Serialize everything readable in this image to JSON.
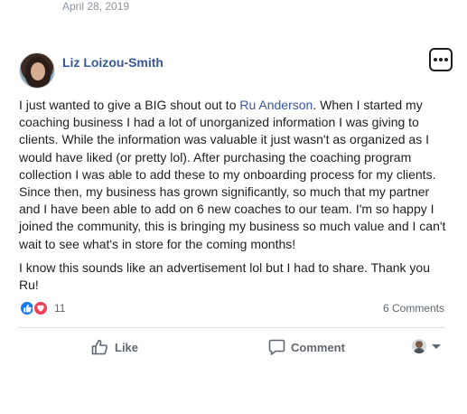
{
  "post": {
    "date_top": "April 28, 2019",
    "author": "Liz Loizou-Smith",
    "body_part1": "I just wanted to give a BIG shout out to ",
    "mention": "Ru Anderson",
    "body_part2": ". When I started my coaching business I had a lot of unorganized information I was giving to clients. While the information was valuable it just wasn't as organized as I would have liked (or pretty lol). After purchasing the coaching program collection I was able to add these to my onboarding process for my clients. Since then, my business has grown significantly, so much that my partner and I have been able to add on 6 new coaches to our team. I'm so happy I joined the community, this is bringing my business so much value and I can't wait to see what's in store for the coming months!",
    "body_para2": "I know this sounds like an advertisement lol but I had to share. Thank you Ru!"
  },
  "reactions": {
    "count": "11",
    "types": [
      "like-icon",
      "love-icon"
    ],
    "like_color": "#1877f2",
    "love_color": "#f33e58"
  },
  "comments_count": "6 Comments",
  "actions": {
    "like_label": "Like",
    "comment_label": "Comment"
  },
  "colors": {
    "link": "#385898",
    "muted": "#606770"
  }
}
